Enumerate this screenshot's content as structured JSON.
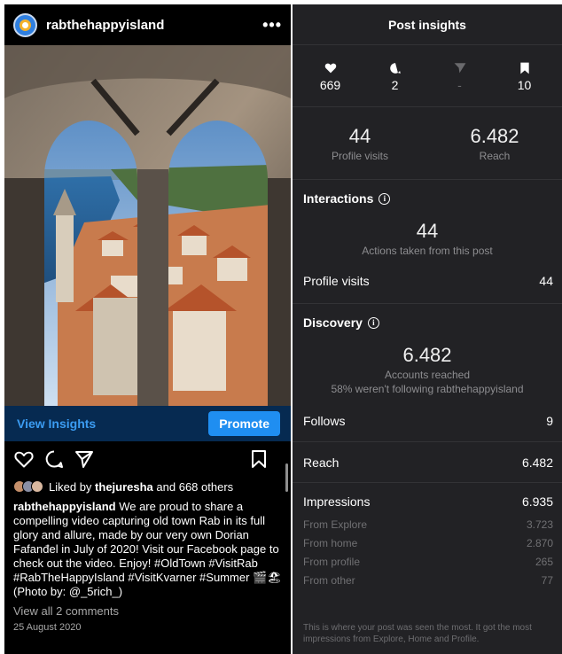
{
  "post": {
    "username": "rabthehappyisland",
    "more_label": "•••",
    "view_insights_label": "View Insights",
    "promote_label": "Promote",
    "liked_by_prefix": "Liked by",
    "liked_by_user": "thejuresha",
    "liked_by_suffix": "and 668 others",
    "caption_username": "rabthehappyisland",
    "caption_text": "We are proud to share a compelling video capturing old town Rab in its full glory and allure, made by our very own Dorian Fafanđel in July of 2020! Visit our Facebook page to check out the video. Enjoy! #OldTown #VisitRab #RabTheHappyIsland #VisitKvarner #Summer 🎬🏖 (Photo by: @_5rich_)",
    "view_comments_label": "View all 2 comments",
    "date": "25 August 2020"
  },
  "insights": {
    "title": "Post insights",
    "stats": [
      {
        "icon": "heart-icon",
        "value": "669"
      },
      {
        "icon": "comment-icon",
        "value": "2"
      },
      {
        "icon": "share-icon",
        "value": "-"
      },
      {
        "icon": "bookmark-icon",
        "value": "10"
      }
    ],
    "profile_visits_value": "44",
    "profile_visits_label": "Profile visits",
    "reach_value": "6.482",
    "reach_label": "Reach",
    "interactions": {
      "title": "Interactions",
      "actions_value": "44",
      "actions_label": "Actions taken from this post",
      "profile_visits_label": "Profile visits",
      "profile_visits_value": "44"
    },
    "discovery": {
      "title": "Discovery",
      "accounts_reached_value": "6.482",
      "accounts_reached_label": "Accounts reached",
      "not_following_text": "58% weren't following rabthehappyisland",
      "follows_label": "Follows",
      "follows_value": "9",
      "reach_label": "Reach",
      "reach_value": "6.482",
      "impressions_label": "Impressions",
      "impressions_value": "6.935",
      "sources": [
        {
          "label": "From Explore",
          "value": "3.723"
        },
        {
          "label": "From home",
          "value": "2.870"
        },
        {
          "label": "From profile",
          "value": "265"
        },
        {
          "label": "From other",
          "value": "77"
        }
      ]
    },
    "footer_text": "This is where your post was seen the most. It got the most impressions from Explore, Home and Profile."
  },
  "colors": {
    "accent_blue": "#1f8ef1",
    "insights_bar": "#062a51",
    "panel_bg": "#222225"
  }
}
